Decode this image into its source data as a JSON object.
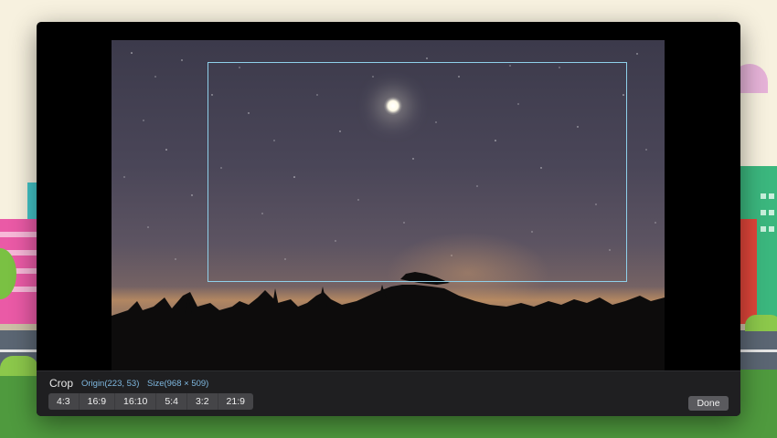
{
  "crop_panel": {
    "title": "Crop",
    "origin": "Origin(223, 53)",
    "size": "Size(968 × 509)",
    "aspect_ratios": [
      "4:3",
      "16:9",
      "16:10",
      "5:4",
      "3:2",
      "21:9"
    ],
    "done_label": "Done"
  },
  "colors": {
    "crop_frame": "#8fd0ea",
    "info_text": "#7fb8e0",
    "toolbar_bg": "#1f1f21"
  }
}
